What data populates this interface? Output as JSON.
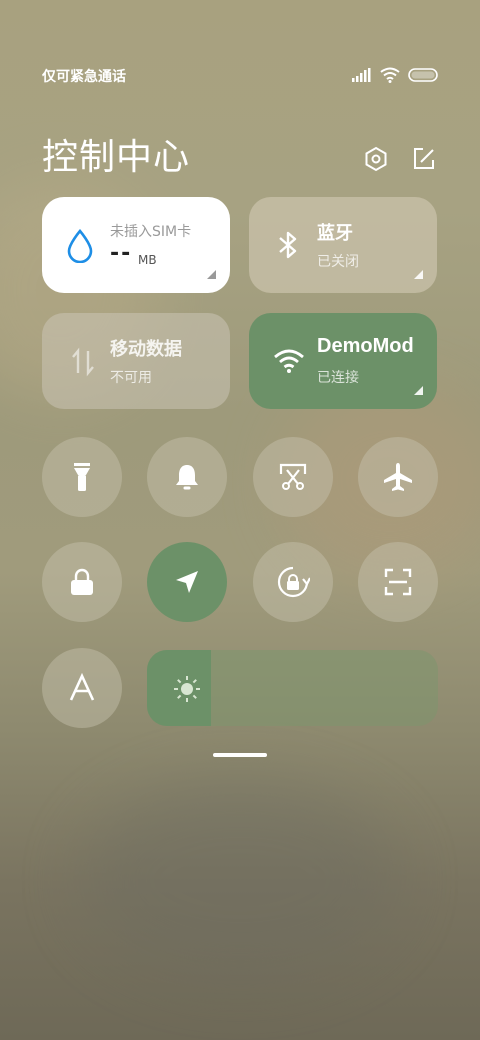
{
  "status_bar": {
    "carrier": "仅可紧急通话"
  },
  "header": {
    "title": "控制中心"
  },
  "tiles": {
    "data_usage": {
      "label": "未插入SIM卡",
      "value": "--",
      "unit": "MB"
    },
    "bluetooth": {
      "label": "蓝牙",
      "status": "已关闭"
    },
    "mobile_data": {
      "label": "移动数据",
      "status": "不可用"
    },
    "wifi": {
      "label": "DemoMod",
      "status": "已连接"
    }
  },
  "toggles": [
    {
      "icon": "flashlight-icon",
      "active": false
    },
    {
      "icon": "bell-icon",
      "active": false
    },
    {
      "icon": "screenshot-icon",
      "active": false
    },
    {
      "icon": "airplane-icon",
      "active": false
    },
    {
      "icon": "lock-icon",
      "active": false
    },
    {
      "icon": "location-icon",
      "active": true
    },
    {
      "icon": "rotation-lock-icon",
      "active": false
    },
    {
      "icon": "scan-icon",
      "active": false
    },
    {
      "icon": "font-a-icon",
      "active": false
    }
  ],
  "brightness": {
    "level_percent": 22
  },
  "colors": {
    "accent_green": "#6c9168",
    "tile_white": "#ffffff",
    "drop_blue": "#1e8ee6"
  }
}
